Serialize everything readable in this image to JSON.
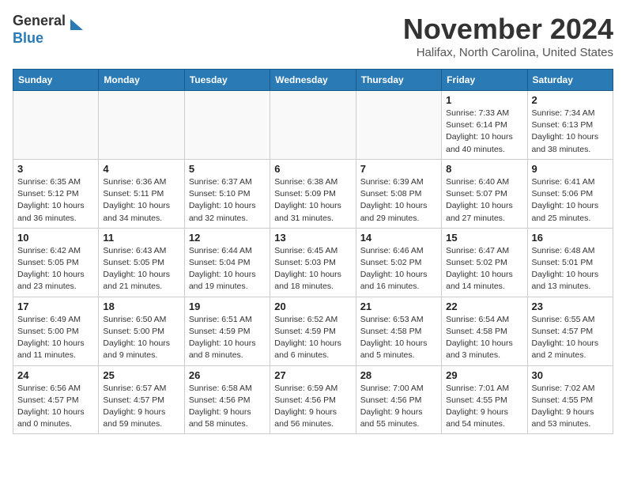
{
  "logo": {
    "line1": "General",
    "line2": "Blue"
  },
  "title": "November 2024",
  "location": "Halifax, North Carolina, United States",
  "weekdays": [
    "Sunday",
    "Monday",
    "Tuesday",
    "Wednesday",
    "Thursday",
    "Friday",
    "Saturday"
  ],
  "weeks": [
    [
      {
        "day": "",
        "info": ""
      },
      {
        "day": "",
        "info": ""
      },
      {
        "day": "",
        "info": ""
      },
      {
        "day": "",
        "info": ""
      },
      {
        "day": "",
        "info": ""
      },
      {
        "day": "1",
        "info": "Sunrise: 7:33 AM\nSunset: 6:14 PM\nDaylight: 10 hours\nand 40 minutes."
      },
      {
        "day": "2",
        "info": "Sunrise: 7:34 AM\nSunset: 6:13 PM\nDaylight: 10 hours\nand 38 minutes."
      }
    ],
    [
      {
        "day": "3",
        "info": "Sunrise: 6:35 AM\nSunset: 5:12 PM\nDaylight: 10 hours\nand 36 minutes."
      },
      {
        "day": "4",
        "info": "Sunrise: 6:36 AM\nSunset: 5:11 PM\nDaylight: 10 hours\nand 34 minutes."
      },
      {
        "day": "5",
        "info": "Sunrise: 6:37 AM\nSunset: 5:10 PM\nDaylight: 10 hours\nand 32 minutes."
      },
      {
        "day": "6",
        "info": "Sunrise: 6:38 AM\nSunset: 5:09 PM\nDaylight: 10 hours\nand 31 minutes."
      },
      {
        "day": "7",
        "info": "Sunrise: 6:39 AM\nSunset: 5:08 PM\nDaylight: 10 hours\nand 29 minutes."
      },
      {
        "day": "8",
        "info": "Sunrise: 6:40 AM\nSunset: 5:07 PM\nDaylight: 10 hours\nand 27 minutes."
      },
      {
        "day": "9",
        "info": "Sunrise: 6:41 AM\nSunset: 5:06 PM\nDaylight: 10 hours\nand 25 minutes."
      }
    ],
    [
      {
        "day": "10",
        "info": "Sunrise: 6:42 AM\nSunset: 5:05 PM\nDaylight: 10 hours\nand 23 minutes."
      },
      {
        "day": "11",
        "info": "Sunrise: 6:43 AM\nSunset: 5:05 PM\nDaylight: 10 hours\nand 21 minutes."
      },
      {
        "day": "12",
        "info": "Sunrise: 6:44 AM\nSunset: 5:04 PM\nDaylight: 10 hours\nand 19 minutes."
      },
      {
        "day": "13",
        "info": "Sunrise: 6:45 AM\nSunset: 5:03 PM\nDaylight: 10 hours\nand 18 minutes."
      },
      {
        "day": "14",
        "info": "Sunrise: 6:46 AM\nSunset: 5:02 PM\nDaylight: 10 hours\nand 16 minutes."
      },
      {
        "day": "15",
        "info": "Sunrise: 6:47 AM\nSunset: 5:02 PM\nDaylight: 10 hours\nand 14 minutes."
      },
      {
        "day": "16",
        "info": "Sunrise: 6:48 AM\nSunset: 5:01 PM\nDaylight: 10 hours\nand 13 minutes."
      }
    ],
    [
      {
        "day": "17",
        "info": "Sunrise: 6:49 AM\nSunset: 5:00 PM\nDaylight: 10 hours\nand 11 minutes."
      },
      {
        "day": "18",
        "info": "Sunrise: 6:50 AM\nSunset: 5:00 PM\nDaylight: 10 hours\nand 9 minutes."
      },
      {
        "day": "19",
        "info": "Sunrise: 6:51 AM\nSunset: 4:59 PM\nDaylight: 10 hours\nand 8 minutes."
      },
      {
        "day": "20",
        "info": "Sunrise: 6:52 AM\nSunset: 4:59 PM\nDaylight: 10 hours\nand 6 minutes."
      },
      {
        "day": "21",
        "info": "Sunrise: 6:53 AM\nSunset: 4:58 PM\nDaylight: 10 hours\nand 5 minutes."
      },
      {
        "day": "22",
        "info": "Sunrise: 6:54 AM\nSunset: 4:58 PM\nDaylight: 10 hours\nand 3 minutes."
      },
      {
        "day": "23",
        "info": "Sunrise: 6:55 AM\nSunset: 4:57 PM\nDaylight: 10 hours\nand 2 minutes."
      }
    ],
    [
      {
        "day": "24",
        "info": "Sunrise: 6:56 AM\nSunset: 4:57 PM\nDaylight: 10 hours\nand 0 minutes."
      },
      {
        "day": "25",
        "info": "Sunrise: 6:57 AM\nSunset: 4:57 PM\nDaylight: 9 hours\nand 59 minutes."
      },
      {
        "day": "26",
        "info": "Sunrise: 6:58 AM\nSunset: 4:56 PM\nDaylight: 9 hours\nand 58 minutes."
      },
      {
        "day": "27",
        "info": "Sunrise: 6:59 AM\nSunset: 4:56 PM\nDaylight: 9 hours\nand 56 minutes."
      },
      {
        "day": "28",
        "info": "Sunrise: 7:00 AM\nSunset: 4:56 PM\nDaylight: 9 hours\nand 55 minutes."
      },
      {
        "day": "29",
        "info": "Sunrise: 7:01 AM\nSunset: 4:55 PM\nDaylight: 9 hours\nand 54 minutes."
      },
      {
        "day": "30",
        "info": "Sunrise: 7:02 AM\nSunset: 4:55 PM\nDaylight: 9 hours\nand 53 minutes."
      }
    ]
  ]
}
